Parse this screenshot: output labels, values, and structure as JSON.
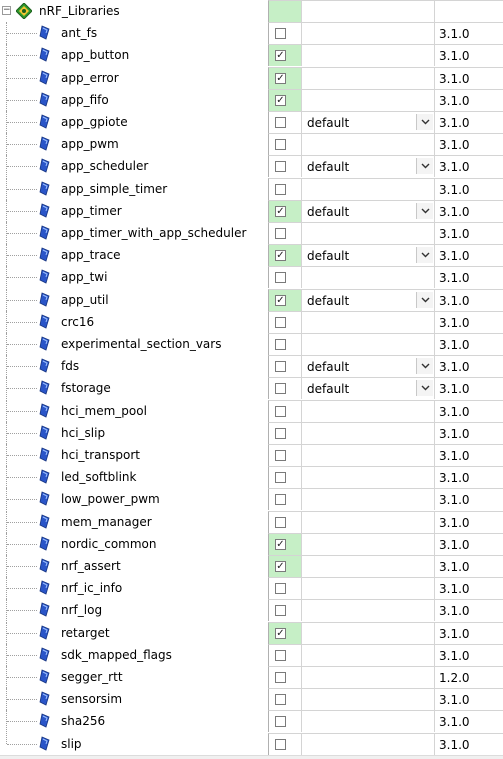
{
  "root": {
    "label": "nRF_Libraries",
    "icon": "component-group-icon",
    "expander_icon": "collapse-minus-icon"
  },
  "colors": {
    "selected_cell": "#c6efc6",
    "grid_line": "#d4d4d4",
    "component_icon": "#2a55c8"
  },
  "components": [
    {
      "name": "ant_fs",
      "checked": false,
      "variant": "",
      "version": "3.1.0"
    },
    {
      "name": "app_button",
      "checked": true,
      "variant": "",
      "version": "3.1.0"
    },
    {
      "name": "app_error",
      "checked": true,
      "variant": "",
      "version": "3.1.0"
    },
    {
      "name": "app_fifo",
      "checked": true,
      "variant": "",
      "version": "3.1.0"
    },
    {
      "name": "app_gpiote",
      "checked": false,
      "variant": "default",
      "version": "3.1.0"
    },
    {
      "name": "app_pwm",
      "checked": false,
      "variant": "",
      "version": "3.1.0"
    },
    {
      "name": "app_scheduler",
      "checked": false,
      "variant": "default",
      "version": "3.1.0"
    },
    {
      "name": "app_simple_timer",
      "checked": false,
      "variant": "",
      "version": "3.1.0"
    },
    {
      "name": "app_timer",
      "checked": true,
      "variant": "default",
      "version": "3.1.0"
    },
    {
      "name": "app_timer_with_app_scheduler",
      "checked": false,
      "variant": "",
      "version": "3.1.0"
    },
    {
      "name": "app_trace",
      "checked": true,
      "variant": "default",
      "version": "3.1.0"
    },
    {
      "name": "app_twi",
      "checked": false,
      "variant": "",
      "version": "3.1.0"
    },
    {
      "name": "app_util",
      "checked": true,
      "variant": "default",
      "version": "3.1.0"
    },
    {
      "name": "crc16",
      "checked": false,
      "variant": "",
      "version": "3.1.0"
    },
    {
      "name": "experimental_section_vars",
      "checked": false,
      "variant": "",
      "version": "3.1.0"
    },
    {
      "name": "fds",
      "checked": false,
      "variant": "default",
      "version": "3.1.0"
    },
    {
      "name": "fstorage",
      "checked": false,
      "variant": "default",
      "version": "3.1.0"
    },
    {
      "name": "hci_mem_pool",
      "checked": false,
      "variant": "",
      "version": "3.1.0"
    },
    {
      "name": "hci_slip",
      "checked": false,
      "variant": "",
      "version": "3.1.0"
    },
    {
      "name": "hci_transport",
      "checked": false,
      "variant": "",
      "version": "3.1.0"
    },
    {
      "name": "led_softblink",
      "checked": false,
      "variant": "",
      "version": "3.1.0"
    },
    {
      "name": "low_power_pwm",
      "checked": false,
      "variant": "",
      "version": "3.1.0"
    },
    {
      "name": "mem_manager",
      "checked": false,
      "variant": "",
      "version": "3.1.0"
    },
    {
      "name": "nordic_common",
      "checked": true,
      "variant": "",
      "version": "3.1.0"
    },
    {
      "name": "nrf_assert",
      "checked": true,
      "variant": "",
      "version": "3.1.0"
    },
    {
      "name": "nrf_ic_info",
      "checked": false,
      "variant": "",
      "version": "3.1.0"
    },
    {
      "name": "nrf_log",
      "checked": false,
      "variant": "",
      "version": "3.1.0"
    },
    {
      "name": "retarget",
      "checked": true,
      "variant": "",
      "version": "3.1.0"
    },
    {
      "name": "sdk_mapped_flags",
      "checked": false,
      "variant": "",
      "version": "3.1.0"
    },
    {
      "name": "segger_rtt",
      "checked": false,
      "variant": "",
      "version": "1.2.0"
    },
    {
      "name": "sensorsim",
      "checked": false,
      "variant": "",
      "version": "3.1.0"
    },
    {
      "name": "sha256",
      "checked": false,
      "variant": "",
      "version": "3.1.0"
    },
    {
      "name": "slip",
      "checked": false,
      "variant": "",
      "version": "3.1.0"
    }
  ]
}
